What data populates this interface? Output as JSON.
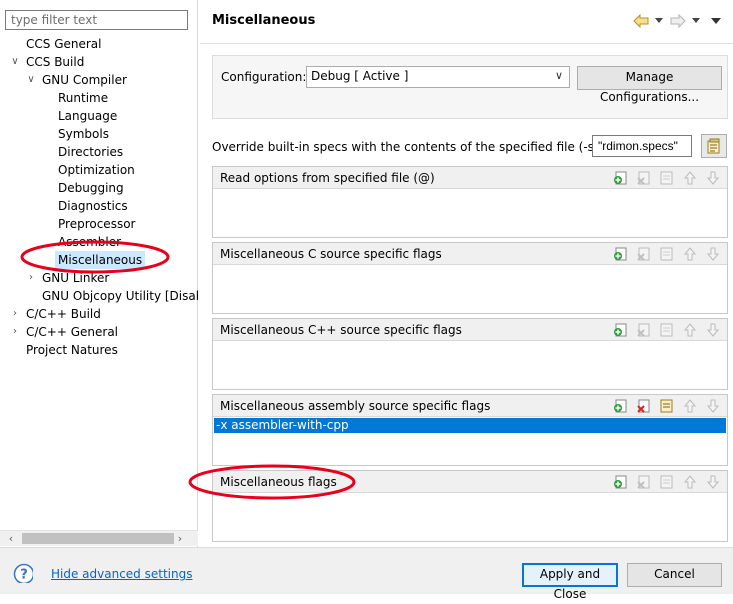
{
  "tree": {
    "filter_placeholder": "type filter text",
    "items": [
      {
        "label": "CCS General",
        "arrow": ""
      },
      {
        "label": "CCS Build",
        "arrow": "expanded"
      },
      {
        "label": "GNU Compiler",
        "arrow": "expanded"
      },
      {
        "label": "Runtime",
        "arrow": ""
      },
      {
        "label": "Language",
        "arrow": ""
      },
      {
        "label": "Symbols",
        "arrow": ""
      },
      {
        "label": "Directories",
        "arrow": ""
      },
      {
        "label": "Optimization",
        "arrow": ""
      },
      {
        "label": "Debugging",
        "arrow": ""
      },
      {
        "label": "Diagnostics",
        "arrow": ""
      },
      {
        "label": "Preprocessor",
        "arrow": ""
      },
      {
        "label": "Assembler",
        "arrow": ""
      },
      {
        "label": "Miscellaneous",
        "arrow": "",
        "selected": true
      },
      {
        "label": "GNU Linker",
        "arrow": "collapsed"
      },
      {
        "label": "GNU Objcopy Utility  [Disab",
        "arrow": ""
      },
      {
        "label": "C/C++ Build",
        "arrow": "collapsed"
      },
      {
        "label": "C/C++ General",
        "arrow": "collapsed"
      },
      {
        "label": "Project Natures",
        "arrow": ""
      }
    ]
  },
  "page": {
    "title": "Miscellaneous",
    "configuration_label": "Configuration:",
    "configuration_value": "Debug  [ Active ]",
    "manage_button": "Manage Configurations...",
    "specs_label": "Override built-in specs with the contents of the specified file (-specs)",
    "specs_value": "\"rdimon.specs\"",
    "groups": [
      {
        "title": "Read options from specified file (@)",
        "items": []
      },
      {
        "title": "Miscellaneous C source specific flags",
        "items": []
      },
      {
        "title": "Miscellaneous C++ source specific flags",
        "items": []
      },
      {
        "title": "Miscellaneous assembly source specific flags",
        "items": [
          "-x assembler-with-cpp"
        ]
      },
      {
        "title": "Miscellaneous flags",
        "items": []
      }
    ]
  },
  "footer": {
    "advanced_link": "Hide advanced settings",
    "apply_button": "Apply and Close",
    "cancel_button": "Cancel"
  },
  "colors": {
    "selection_blue": "#0078d7",
    "tree_selection": "#cce8ff",
    "annotation_red": "#e8001c",
    "link_blue": "#0066cc"
  }
}
